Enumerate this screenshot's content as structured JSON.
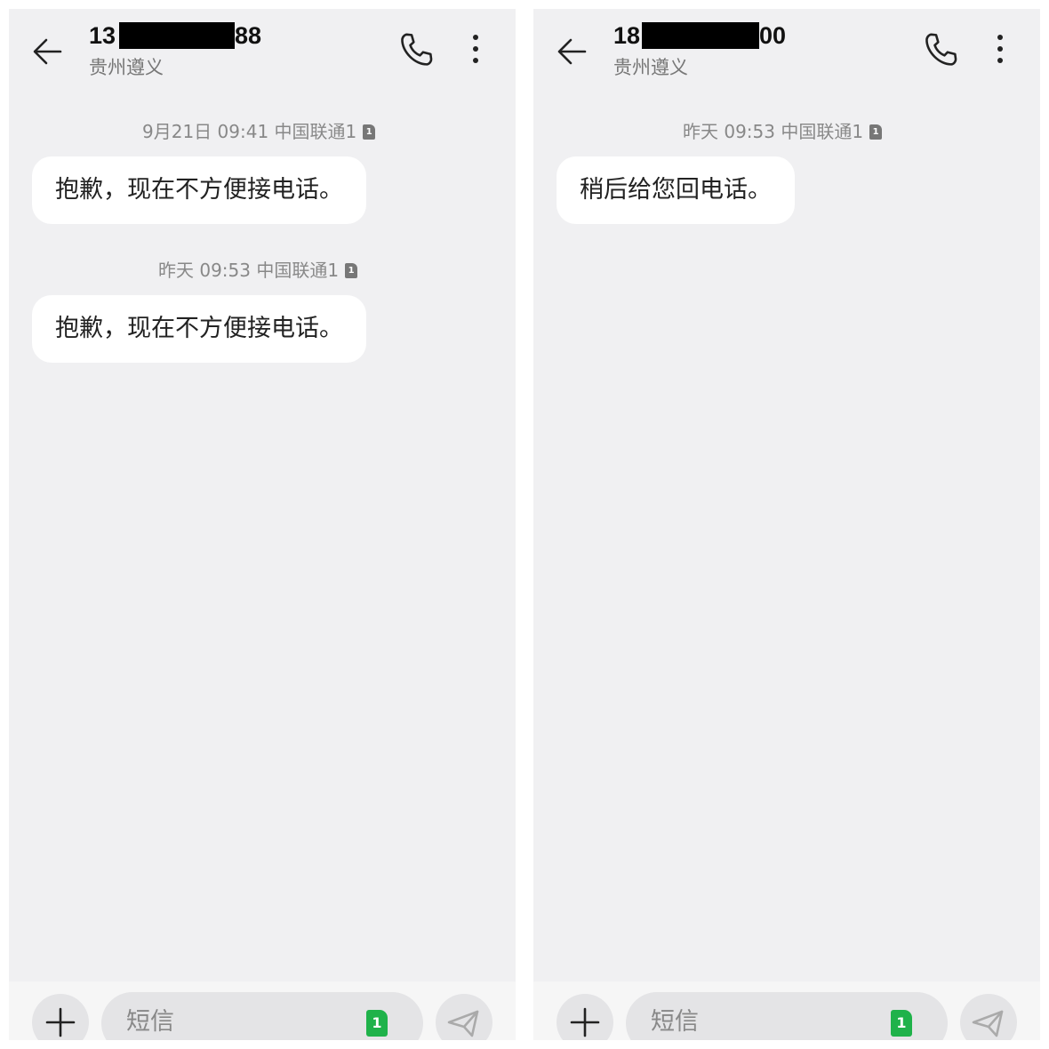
{
  "colors": {
    "background": "#f0f0f2",
    "bubble": "#ffffff",
    "sim_badge": "#1fb24a",
    "redaction": "#000000"
  },
  "icons": [
    "back-arrow-icon",
    "phone-icon",
    "more-vertical-icon",
    "plus-icon",
    "sim-card-icon",
    "send-icon"
  ],
  "conversations": [
    {
      "header": {
        "phone_prefix": "13",
        "phone_suffix": "88",
        "location": "贵州遵义"
      },
      "messages": [
        {
          "timestamp": "9月21日 09:41 中国联通1",
          "sim": "1",
          "text": "抱歉，现在不方便接电话。"
        },
        {
          "timestamp": "昨天 09:53 中国联通1",
          "sim": "1",
          "text": "抱歉，现在不方便接电话。"
        }
      ],
      "input": {
        "placeholder": "短信",
        "sim_badge": "1"
      }
    },
    {
      "header": {
        "phone_prefix": "18",
        "phone_suffix": "00",
        "location": "贵州遵义"
      },
      "messages": [
        {
          "timestamp": "昨天 09:53 中国联通1",
          "sim": "1",
          "text": "稍后给您回电话。"
        }
      ],
      "input": {
        "placeholder": "短信",
        "sim_badge": "1"
      }
    }
  ]
}
